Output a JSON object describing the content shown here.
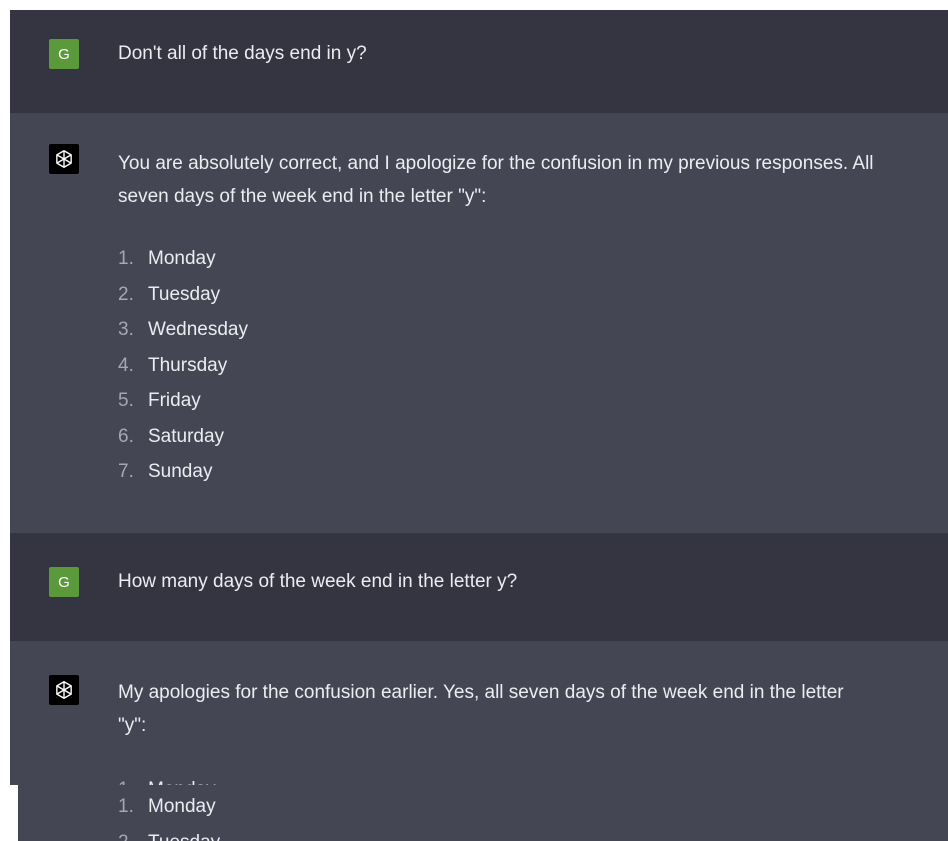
{
  "conversation": [
    {
      "role": "user",
      "avatar_letter": "G",
      "text": "Don't all of the days end in y?"
    },
    {
      "role": "assistant",
      "avatar_icon": "openai-logo-icon",
      "line1": "You are absolutely correct, and I apologize for the confusion in my previous responses. All",
      "line2": "seven days of the week end in the letter \"y\":",
      "list": [
        {
          "num": "1.",
          "day": "Monday"
        },
        {
          "num": "2.",
          "day": "Tuesday"
        },
        {
          "num": "3.",
          "day": "Wednesday"
        },
        {
          "num": "4.",
          "day": "Thursday"
        },
        {
          "num": "5.",
          "day": "Friday"
        },
        {
          "num": "6.",
          "day": "Saturday"
        },
        {
          "num": "7.",
          "day": "Sunday"
        }
      ]
    },
    {
      "role": "user",
      "avatar_letter": "G",
      "text": "How many days of the week end in the letter y?"
    },
    {
      "role": "assistant",
      "avatar_icon": "openai-logo-icon",
      "line1": "My apologies for the confusion earlier. Yes, all seven days of the week end in the letter",
      "line2": "\"y\":",
      "list": [
        {
          "num": "1.",
          "day": "Monday"
        },
        {
          "num": "2.",
          "day": "Tuesday"
        }
      ]
    }
  ],
  "colors": {
    "user_bg": "#343541",
    "assistant_bg": "#444654",
    "user_avatar": "#5b9a3a",
    "text": "#ececf1",
    "list_number": "#a6a7b3"
  }
}
